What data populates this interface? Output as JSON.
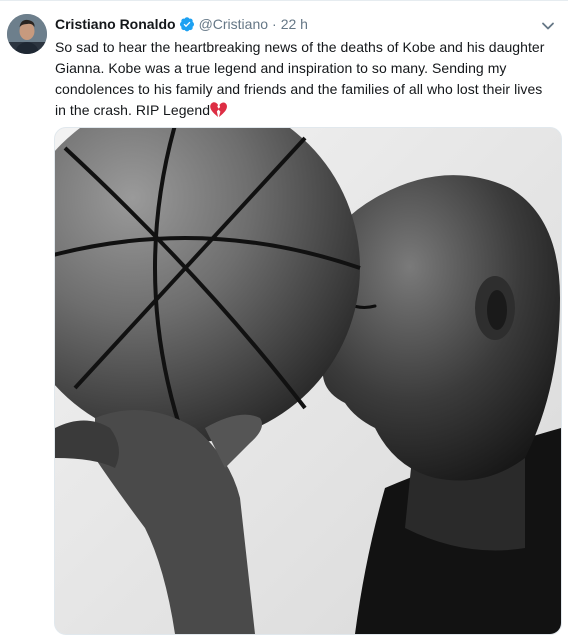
{
  "tweet": {
    "author_name": "Cristiano Ronaldo",
    "handle": "@Cristiano",
    "separator": "·",
    "time": "22 h",
    "text": "So sad to hear the heartbreaking news of the deaths of Kobe and his daughter Gianna. Kobe was a true legend and inspiration to so many. Sending my condolences to his family and friends and the families of all who lost their lives in the crash. RIP Legend",
    "emoji": "broken-heart",
    "icons": {
      "verified": "verified-badge-icon",
      "menu": "chevron-down-icon"
    },
    "colors": {
      "verified": "#1da1f2",
      "secondary_text": "#657786",
      "broken_heart": "#e0245e"
    }
  }
}
